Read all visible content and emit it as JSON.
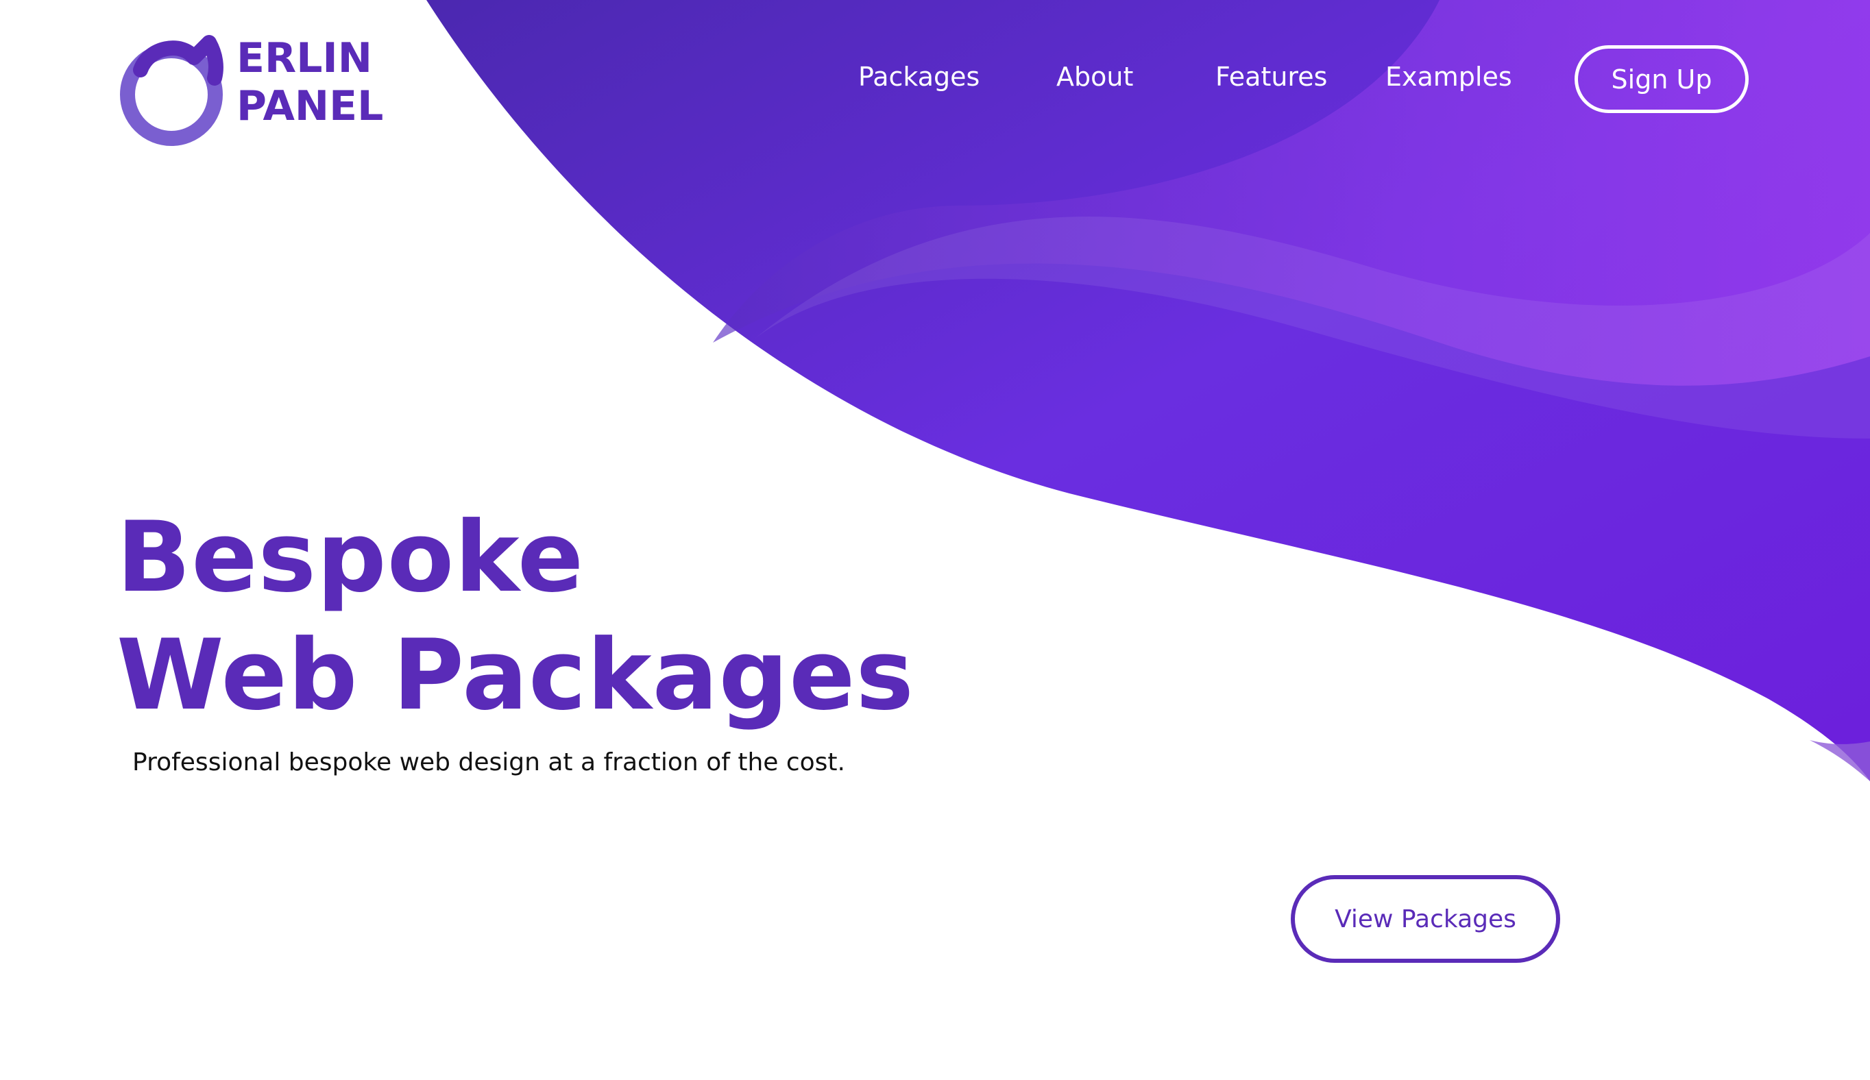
{
  "brand": {
    "logo_line1": "ERLIN",
    "logo_line2": "PANEL",
    "logo_icon": "merlin-cat-circle-icon",
    "color": "#5a2bb8"
  },
  "nav": {
    "items": [
      {
        "label": "Packages"
      },
      {
        "label": "About"
      },
      {
        "label": "Features"
      },
      {
        "label": "Examples"
      }
    ],
    "signup_label": "Sign Up"
  },
  "hero": {
    "headline_line1": "Bespoke",
    "headline_line2": "Web Packages",
    "subtitle": "Professional bespoke web design at a fraction of the cost.",
    "cta_label": "View Packages"
  },
  "colors": {
    "primary": "#5a2bb8",
    "gradient_start": "#5330b8",
    "gradient_end": "#a13ff0",
    "text_dark": "#111111",
    "white": "#ffffff"
  }
}
